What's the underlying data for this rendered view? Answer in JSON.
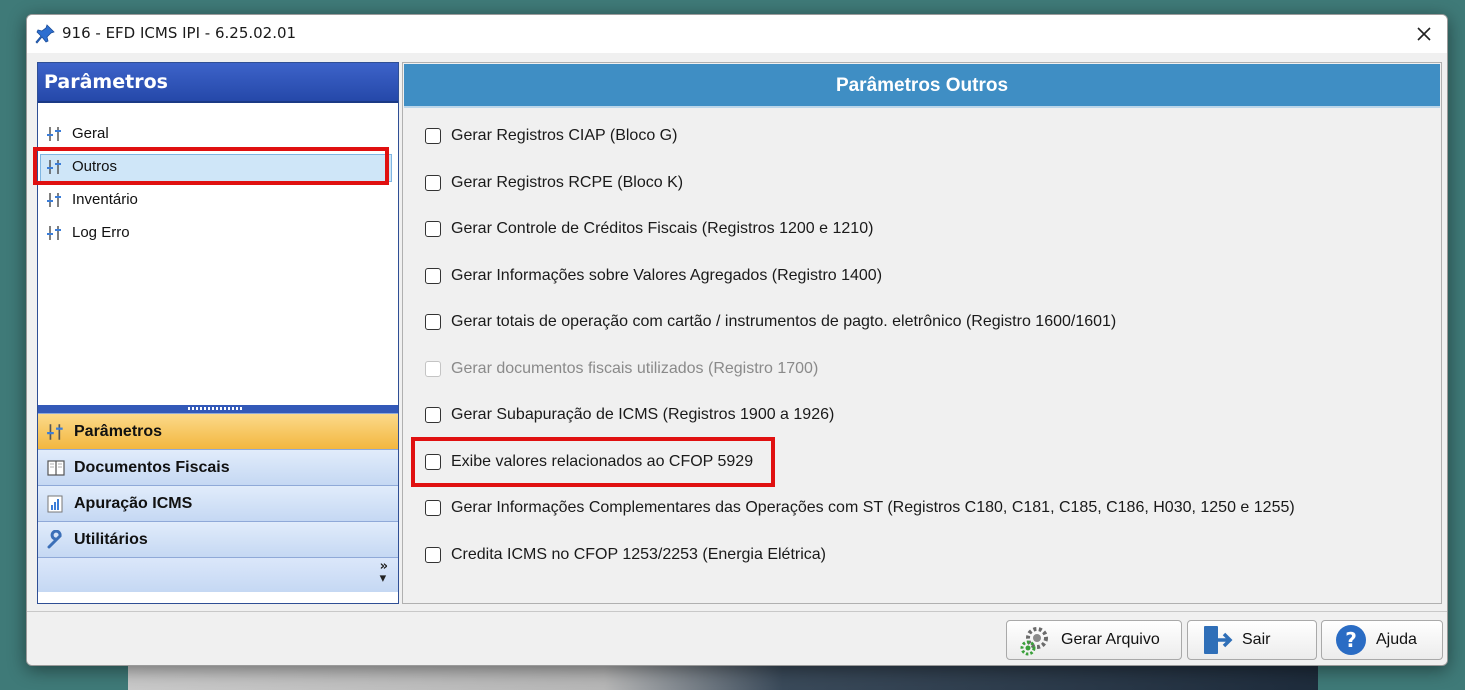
{
  "window": {
    "title": "916 - EFD ICMS IPI - 6.25.02.01"
  },
  "left_pane": {
    "header": "Parâmetros",
    "tree_items": [
      {
        "label": "Geral",
        "selected": false
      },
      {
        "label": "Outros",
        "selected": true
      },
      {
        "label": "Inventário",
        "selected": false
      },
      {
        "label": "Log Erro",
        "selected": false
      }
    ],
    "nav_buttons": [
      {
        "label": "Parâmetros",
        "active": true,
        "icon": "sliders-icon"
      },
      {
        "label": "Documentos Fiscais",
        "active": false,
        "icon": "book-icon"
      },
      {
        "label": "Apuração ICMS",
        "active": false,
        "icon": "chart-icon"
      },
      {
        "label": "Utilitários",
        "active": false,
        "icon": "wrench-icon"
      }
    ],
    "footer_chevron": "»"
  },
  "right_pane": {
    "header": "Parâmetros Outros",
    "options": [
      {
        "label": "Gerar Registros CIAP (Bloco G)",
        "checked": false,
        "enabled": true
      },
      {
        "label": "Gerar Registros RCPE (Bloco K)",
        "checked": false,
        "enabled": true
      },
      {
        "label": "Gerar Controle de Créditos Fiscais (Registros 1200 e 1210)",
        "checked": false,
        "enabled": true
      },
      {
        "label": "Gerar Informações sobre Valores Agregados (Registro 1400)",
        "checked": false,
        "enabled": true
      },
      {
        "label": "Gerar totais de operação com cartão / instrumentos de pagto. eletrônico (Registro 1600/1601)",
        "checked": false,
        "enabled": true
      },
      {
        "label": "Gerar documentos fiscais utilizados (Registro 1700)",
        "checked": false,
        "enabled": false
      },
      {
        "label": "Gerar Subapuração de ICMS (Registros 1900 a 1926)",
        "checked": false,
        "enabled": true
      },
      {
        "label": "Exibe valores relacionados ao CFOP 5929",
        "checked": false,
        "enabled": true
      },
      {
        "label": "Gerar Informações Complementares das Operações com ST (Registros C180, C181, C185, C186, H030, 1250 e 1255)",
        "checked": false,
        "enabled": true
      },
      {
        "label": "Credita ICMS no CFOP 1253/2253 (Energia Elétrica)",
        "checked": false,
        "enabled": true
      }
    ]
  },
  "buttons": {
    "gerar": "Gerar Arquivo",
    "sair": "Sair",
    "ajuda": "Ajuda"
  },
  "colors": {
    "highlight": "#e01010",
    "left_header": "#2f55b8",
    "right_header": "#3f8ec4",
    "active_nav": "#f3b73f"
  }
}
